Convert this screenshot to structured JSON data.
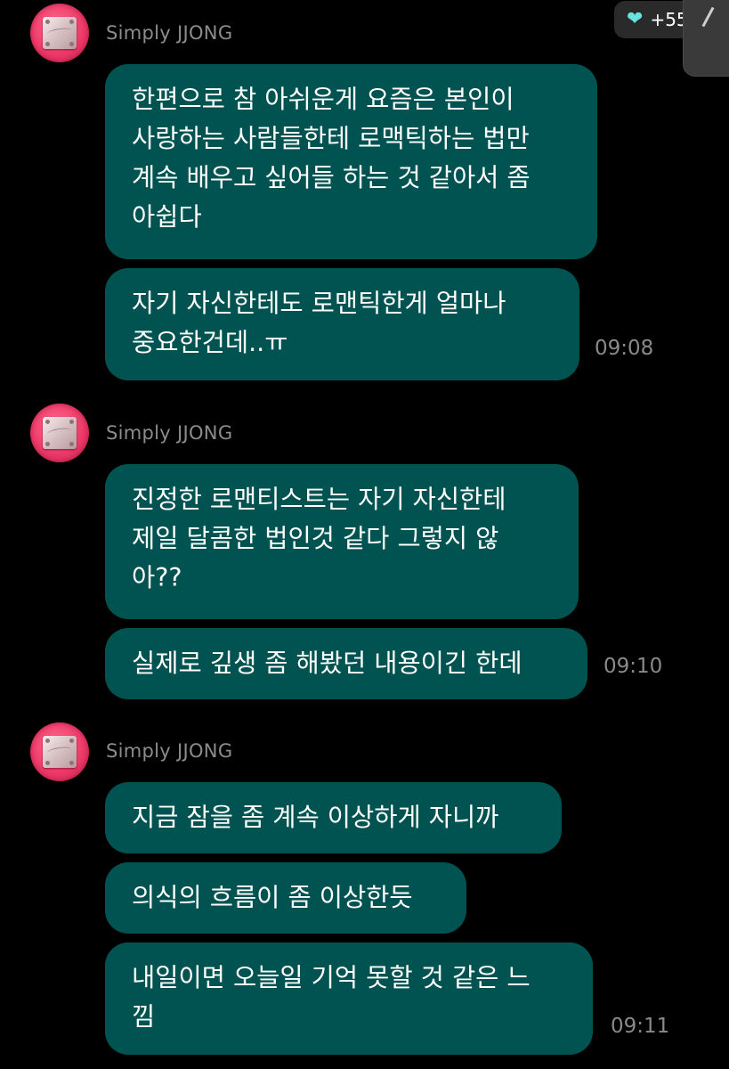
{
  "reaction_badge": {
    "icon": "heart-icon",
    "count": "+55"
  },
  "groups": [
    {
      "sender": "Simply JJONG",
      "messages": [
        {
          "text": "한편으로 참 아쉬운게 요즘은 본인이\n사랑하는 사람들한테 로맥틱하는 법만\n계속 배우고 싶어들 하는 것 같아서 좀\n아쉽다"
        },
        {
          "text": "자기 자신한테도 로맨틱한게 얼마나\n중요한건데..ㅠ"
        }
      ],
      "time": "09:08"
    },
    {
      "sender": "Simply JJONG",
      "messages": [
        {
          "text": "진정한 로맨티스트는 자기 자신한테\n제일 달콤한 법인것 같다 그렇지 않\n아??"
        },
        {
          "text": "실제로 깊생 좀 해봤던 내용이긴 한데"
        }
      ],
      "time": "09:10"
    },
    {
      "sender": "Simply JJONG",
      "messages": [
        {
          "text": "지금 잠을 좀 계속 이상하게 자니까"
        },
        {
          "text": "의식의 흐름이 좀 이상한듯"
        },
        {
          "text": "내일이면 오늘일 기억 못할 것 같은 느\n낌"
        }
      ],
      "time": "09:11"
    }
  ],
  "colors": {
    "background": "#000000",
    "bubble": "#005350",
    "sender_name": "#8c8c8c",
    "timestamp": "#8a8a8a",
    "heart": "#66e3de",
    "avatar": "#ee3a6a"
  }
}
